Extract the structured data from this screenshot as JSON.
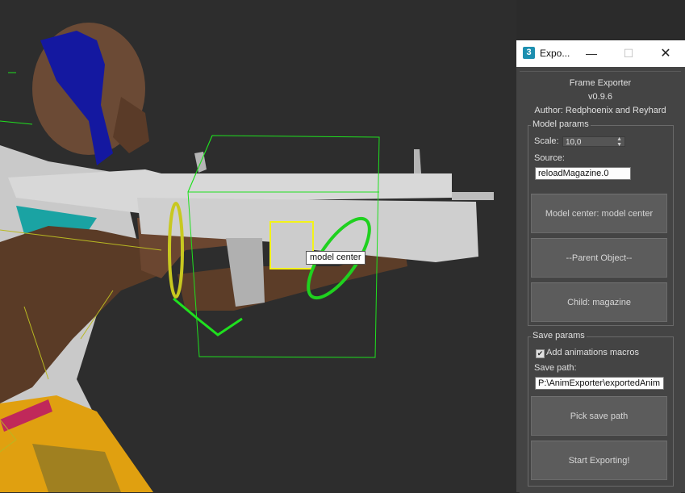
{
  "viewport": {
    "tooltip": "model center"
  },
  "window": {
    "app_icon": "3",
    "title": "Expo...",
    "minimize": "—",
    "maximize": "☐",
    "close": "✕"
  },
  "header": {
    "name": "Frame Exporter",
    "version": "v0.9.6",
    "author": "Author: Redphoenix and Reyhard"
  },
  "model_params": {
    "group_label": "Model params",
    "scale_label": "Scale:",
    "scale_value": "10,0",
    "source_label": "Source:",
    "source_value": "reloadMagazine.0",
    "model_center_button": "Model center: model center",
    "parent_object_button": "--Parent Object--",
    "child_button": "Child: magazine"
  },
  "save_params": {
    "group_label": "Save params",
    "add_macros_checked": true,
    "add_macros_label": "Add animations macros",
    "save_path_label": "Save path:",
    "save_path_value": "P:\\AnimExporter\\exportedAnim",
    "pick_save_path_button": "Pick save path",
    "start_exporting_button": "Start Exporting!"
  }
}
